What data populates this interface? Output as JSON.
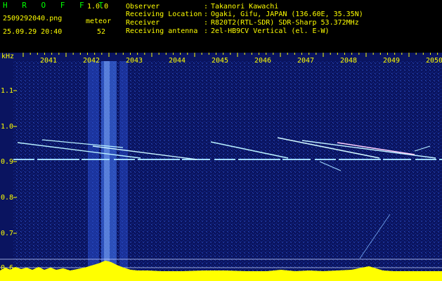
{
  "header": {
    "app_title": "H R O F F T",
    "version": "1.0.0",
    "filename": "2509292040.png",
    "datetime": "25.09.29 20:40",
    "meteor_label": "meteor",
    "meteor_count": "52",
    "info": [
      {
        "label": "Observer",
        "value": "Takanori Kawachi"
      },
      {
        "label": "Receiving Location",
        "value": "Ogaki, Gifu, JAPAN (136.60E, 35.35N)"
      },
      {
        "label": "Receiver",
        "value": "R820T2(RTL-SDR) SDR-Sharp 53.372MHz"
      },
      {
        "label": "Receiving antenna",
        "value": "2el-HB9CV Vertical (el. E-W)"
      }
    ]
  },
  "spectrogram": {
    "y_unit": "kHz",
    "y_ticks": [
      "1.1",
      "1.0",
      "0.9",
      "0.8",
      "0.7",
      "0.6"
    ],
    "x_ticks": [
      "2041",
      "2042",
      "2043",
      "2044",
      "2045",
      "2046",
      "2047",
      "2048",
      "2049",
      "2050"
    ],
    "colors": {
      "background": "#0a1460",
      "noise": "#1c3aa8",
      "tick_text": "#ffff00",
      "carrier": "#9fd8ff",
      "meteor": "#b8f0ff",
      "spectrum_fill": "#ffff00",
      "spectrum_base": "#00ffff"
    }
  }
}
